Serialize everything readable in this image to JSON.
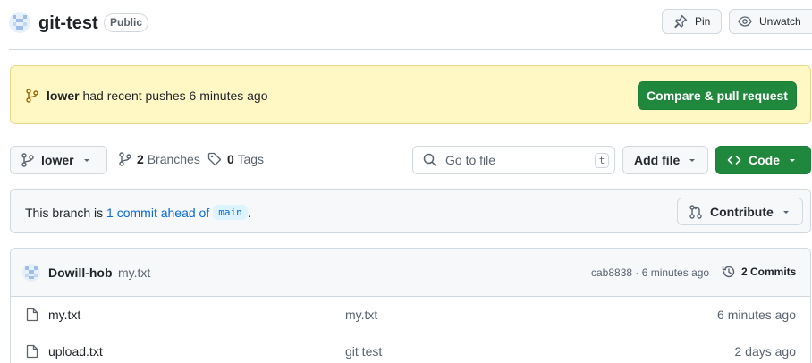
{
  "repo": {
    "name": "git-test",
    "visibility": "Public"
  },
  "header_actions": {
    "pin_label": "Pin",
    "unwatch_label": "Unwatch"
  },
  "push_banner": {
    "branch": "lower",
    "message": " had recent pushes 6 minutes ago",
    "button_label": "Compare & pull request"
  },
  "toolbar": {
    "current_branch": "lower",
    "branches_count": "2",
    "branches_label": "Branches",
    "tags_count": "0",
    "tags_label": "Tags",
    "search_placeholder": "Go to file",
    "search_shortcut": "t",
    "add_file_label": "Add file",
    "code_label": "Code"
  },
  "ahead": {
    "prefix": "This branch is ",
    "link": "1 commit ahead of",
    "base_branch": "main",
    "suffix": ".",
    "contribute_label": "Contribute"
  },
  "latest_commit": {
    "author": "Dowill-hob",
    "message": "my.txt",
    "meta": "cab8838 · 6 minutes ago",
    "commits_label": "2 Commits"
  },
  "files": [
    {
      "name": "my.txt",
      "commit": "my.txt",
      "time": "6 minutes ago"
    },
    {
      "name": "upload.txt",
      "commit": "git test",
      "time": "2 days ago"
    }
  ],
  "colors": {
    "accent_green": "#1f883d",
    "banner_bg": "#fff8c5",
    "link_blue": "#0969da"
  }
}
